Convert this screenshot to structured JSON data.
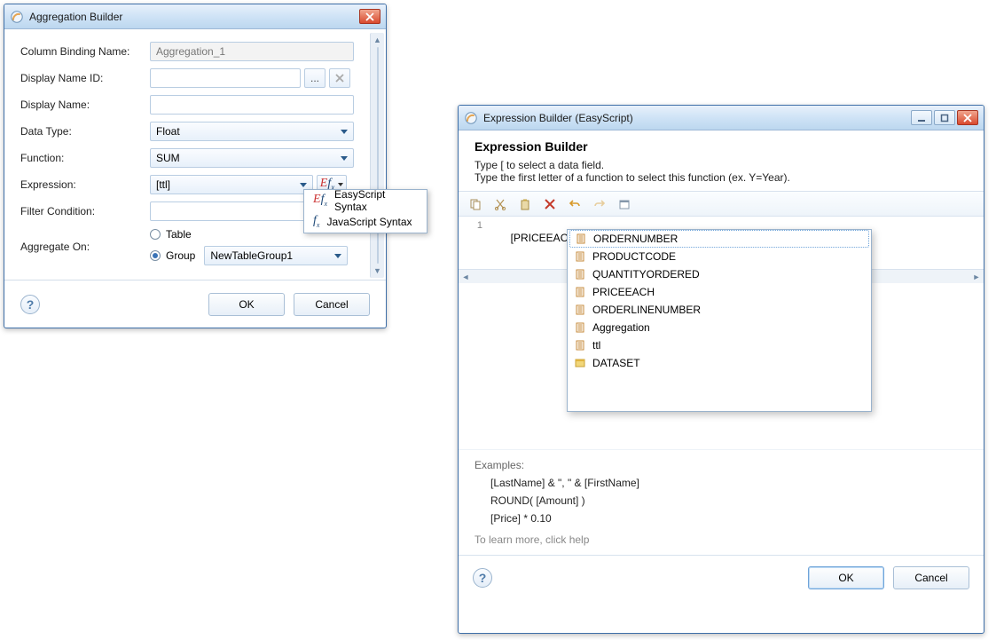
{
  "agg": {
    "title": "Aggregation Builder",
    "labels": {
      "binding": "Column Binding Name:",
      "display_id": "Display Name ID:",
      "display_name": "Display Name:",
      "data_type": "Data Type:",
      "function": "Function:",
      "expression": "Expression:",
      "filter": "Filter Condition:",
      "aggregate_on": "Aggregate On:",
      "table": "Table",
      "group": "Group"
    },
    "values": {
      "binding": "Aggregation_1",
      "display_id": "",
      "display_name": "",
      "data_type": "Float",
      "function": "SUM",
      "expression": "[ttl]",
      "filter": "",
      "group": "NewTableGroup1",
      "aggregate_on_selected": "group"
    },
    "ellipsis": "...",
    "fx_menu": {
      "easy": "EasyScript Syntax",
      "js": "JavaScript Syntax"
    },
    "buttons": {
      "ok": "OK",
      "cancel": "Cancel"
    }
  },
  "expr": {
    "title": "Expression Builder (EasyScript)",
    "heading": "Expression Builder",
    "hint1": "Type [ to select a data field.",
    "hint2": "Type the first letter of a function to select this function (ex. Y=Year).",
    "gutter_line": "1",
    "code_text": "[PRICEEACH]*[",
    "suggestions": [
      "ORDERNUMBER",
      "PRODUCTCODE",
      "QUANTITYORDERED",
      "PRICEEACH",
      "ORDERLINENUMBER",
      "Aggregation",
      "ttl",
      "DATASET"
    ],
    "selected_index": 0,
    "examples_label": "Examples:",
    "examples": [
      "[LastName] & \", \" & [FirstName]",
      "ROUND( [Amount] )",
      "[Price] * 0.10"
    ],
    "learn_more": "To learn more, click help",
    "buttons": {
      "ok": "OK",
      "cancel": "Cancel"
    }
  }
}
